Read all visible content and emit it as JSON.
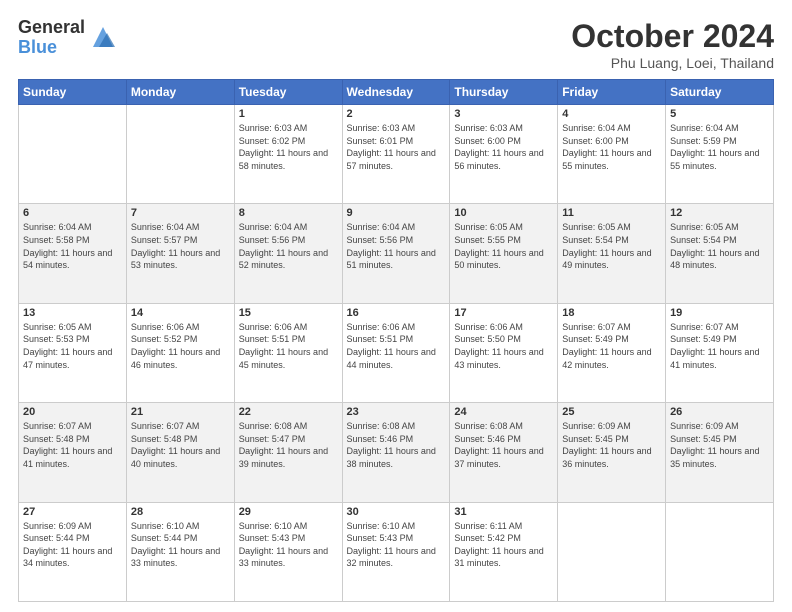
{
  "header": {
    "logo": {
      "general": "General",
      "blue": "Blue"
    },
    "title": "October 2024",
    "location": "Phu Luang, Loei, Thailand"
  },
  "weekdays": [
    "Sunday",
    "Monday",
    "Tuesday",
    "Wednesday",
    "Thursday",
    "Friday",
    "Saturday"
  ],
  "weeks": [
    [
      {
        "day": "",
        "sunrise": "",
        "sunset": "",
        "daylight": ""
      },
      {
        "day": "",
        "sunrise": "",
        "sunset": "",
        "daylight": ""
      },
      {
        "day": "1",
        "sunrise": "Sunrise: 6:03 AM",
        "sunset": "Sunset: 6:02 PM",
        "daylight": "Daylight: 11 hours and 58 minutes."
      },
      {
        "day": "2",
        "sunrise": "Sunrise: 6:03 AM",
        "sunset": "Sunset: 6:01 PM",
        "daylight": "Daylight: 11 hours and 57 minutes."
      },
      {
        "day": "3",
        "sunrise": "Sunrise: 6:03 AM",
        "sunset": "Sunset: 6:00 PM",
        "daylight": "Daylight: 11 hours and 56 minutes."
      },
      {
        "day": "4",
        "sunrise": "Sunrise: 6:04 AM",
        "sunset": "Sunset: 6:00 PM",
        "daylight": "Daylight: 11 hours and 55 minutes."
      },
      {
        "day": "5",
        "sunrise": "Sunrise: 6:04 AM",
        "sunset": "Sunset: 5:59 PM",
        "daylight": "Daylight: 11 hours and 55 minutes."
      }
    ],
    [
      {
        "day": "6",
        "sunrise": "Sunrise: 6:04 AM",
        "sunset": "Sunset: 5:58 PM",
        "daylight": "Daylight: 11 hours and 54 minutes."
      },
      {
        "day": "7",
        "sunrise": "Sunrise: 6:04 AM",
        "sunset": "Sunset: 5:57 PM",
        "daylight": "Daylight: 11 hours and 53 minutes."
      },
      {
        "day": "8",
        "sunrise": "Sunrise: 6:04 AM",
        "sunset": "Sunset: 5:56 PM",
        "daylight": "Daylight: 11 hours and 52 minutes."
      },
      {
        "day": "9",
        "sunrise": "Sunrise: 6:04 AM",
        "sunset": "Sunset: 5:56 PM",
        "daylight": "Daylight: 11 hours and 51 minutes."
      },
      {
        "day": "10",
        "sunrise": "Sunrise: 6:05 AM",
        "sunset": "Sunset: 5:55 PM",
        "daylight": "Daylight: 11 hours and 50 minutes."
      },
      {
        "day": "11",
        "sunrise": "Sunrise: 6:05 AM",
        "sunset": "Sunset: 5:54 PM",
        "daylight": "Daylight: 11 hours and 49 minutes."
      },
      {
        "day": "12",
        "sunrise": "Sunrise: 6:05 AM",
        "sunset": "Sunset: 5:54 PM",
        "daylight": "Daylight: 11 hours and 48 minutes."
      }
    ],
    [
      {
        "day": "13",
        "sunrise": "Sunrise: 6:05 AM",
        "sunset": "Sunset: 5:53 PM",
        "daylight": "Daylight: 11 hours and 47 minutes."
      },
      {
        "day": "14",
        "sunrise": "Sunrise: 6:06 AM",
        "sunset": "Sunset: 5:52 PM",
        "daylight": "Daylight: 11 hours and 46 minutes."
      },
      {
        "day": "15",
        "sunrise": "Sunrise: 6:06 AM",
        "sunset": "Sunset: 5:51 PM",
        "daylight": "Daylight: 11 hours and 45 minutes."
      },
      {
        "day": "16",
        "sunrise": "Sunrise: 6:06 AM",
        "sunset": "Sunset: 5:51 PM",
        "daylight": "Daylight: 11 hours and 44 minutes."
      },
      {
        "day": "17",
        "sunrise": "Sunrise: 6:06 AM",
        "sunset": "Sunset: 5:50 PM",
        "daylight": "Daylight: 11 hours and 43 minutes."
      },
      {
        "day": "18",
        "sunrise": "Sunrise: 6:07 AM",
        "sunset": "Sunset: 5:49 PM",
        "daylight": "Daylight: 11 hours and 42 minutes."
      },
      {
        "day": "19",
        "sunrise": "Sunrise: 6:07 AM",
        "sunset": "Sunset: 5:49 PM",
        "daylight": "Daylight: 11 hours and 41 minutes."
      }
    ],
    [
      {
        "day": "20",
        "sunrise": "Sunrise: 6:07 AM",
        "sunset": "Sunset: 5:48 PM",
        "daylight": "Daylight: 11 hours and 41 minutes."
      },
      {
        "day": "21",
        "sunrise": "Sunrise: 6:07 AM",
        "sunset": "Sunset: 5:48 PM",
        "daylight": "Daylight: 11 hours and 40 minutes."
      },
      {
        "day": "22",
        "sunrise": "Sunrise: 6:08 AM",
        "sunset": "Sunset: 5:47 PM",
        "daylight": "Daylight: 11 hours and 39 minutes."
      },
      {
        "day": "23",
        "sunrise": "Sunrise: 6:08 AM",
        "sunset": "Sunset: 5:46 PM",
        "daylight": "Daylight: 11 hours and 38 minutes."
      },
      {
        "day": "24",
        "sunrise": "Sunrise: 6:08 AM",
        "sunset": "Sunset: 5:46 PM",
        "daylight": "Daylight: 11 hours and 37 minutes."
      },
      {
        "day": "25",
        "sunrise": "Sunrise: 6:09 AM",
        "sunset": "Sunset: 5:45 PM",
        "daylight": "Daylight: 11 hours and 36 minutes."
      },
      {
        "day": "26",
        "sunrise": "Sunrise: 6:09 AM",
        "sunset": "Sunset: 5:45 PM",
        "daylight": "Daylight: 11 hours and 35 minutes."
      }
    ],
    [
      {
        "day": "27",
        "sunrise": "Sunrise: 6:09 AM",
        "sunset": "Sunset: 5:44 PM",
        "daylight": "Daylight: 11 hours and 34 minutes."
      },
      {
        "day": "28",
        "sunrise": "Sunrise: 6:10 AM",
        "sunset": "Sunset: 5:44 PM",
        "daylight": "Daylight: 11 hours and 33 minutes."
      },
      {
        "day": "29",
        "sunrise": "Sunrise: 6:10 AM",
        "sunset": "Sunset: 5:43 PM",
        "daylight": "Daylight: 11 hours and 33 minutes."
      },
      {
        "day": "30",
        "sunrise": "Sunrise: 6:10 AM",
        "sunset": "Sunset: 5:43 PM",
        "daylight": "Daylight: 11 hours and 32 minutes."
      },
      {
        "day": "31",
        "sunrise": "Sunrise: 6:11 AM",
        "sunset": "Sunset: 5:42 PM",
        "daylight": "Daylight: 11 hours and 31 minutes."
      },
      {
        "day": "",
        "sunrise": "",
        "sunset": "",
        "daylight": ""
      },
      {
        "day": "",
        "sunrise": "",
        "sunset": "",
        "daylight": ""
      }
    ]
  ]
}
